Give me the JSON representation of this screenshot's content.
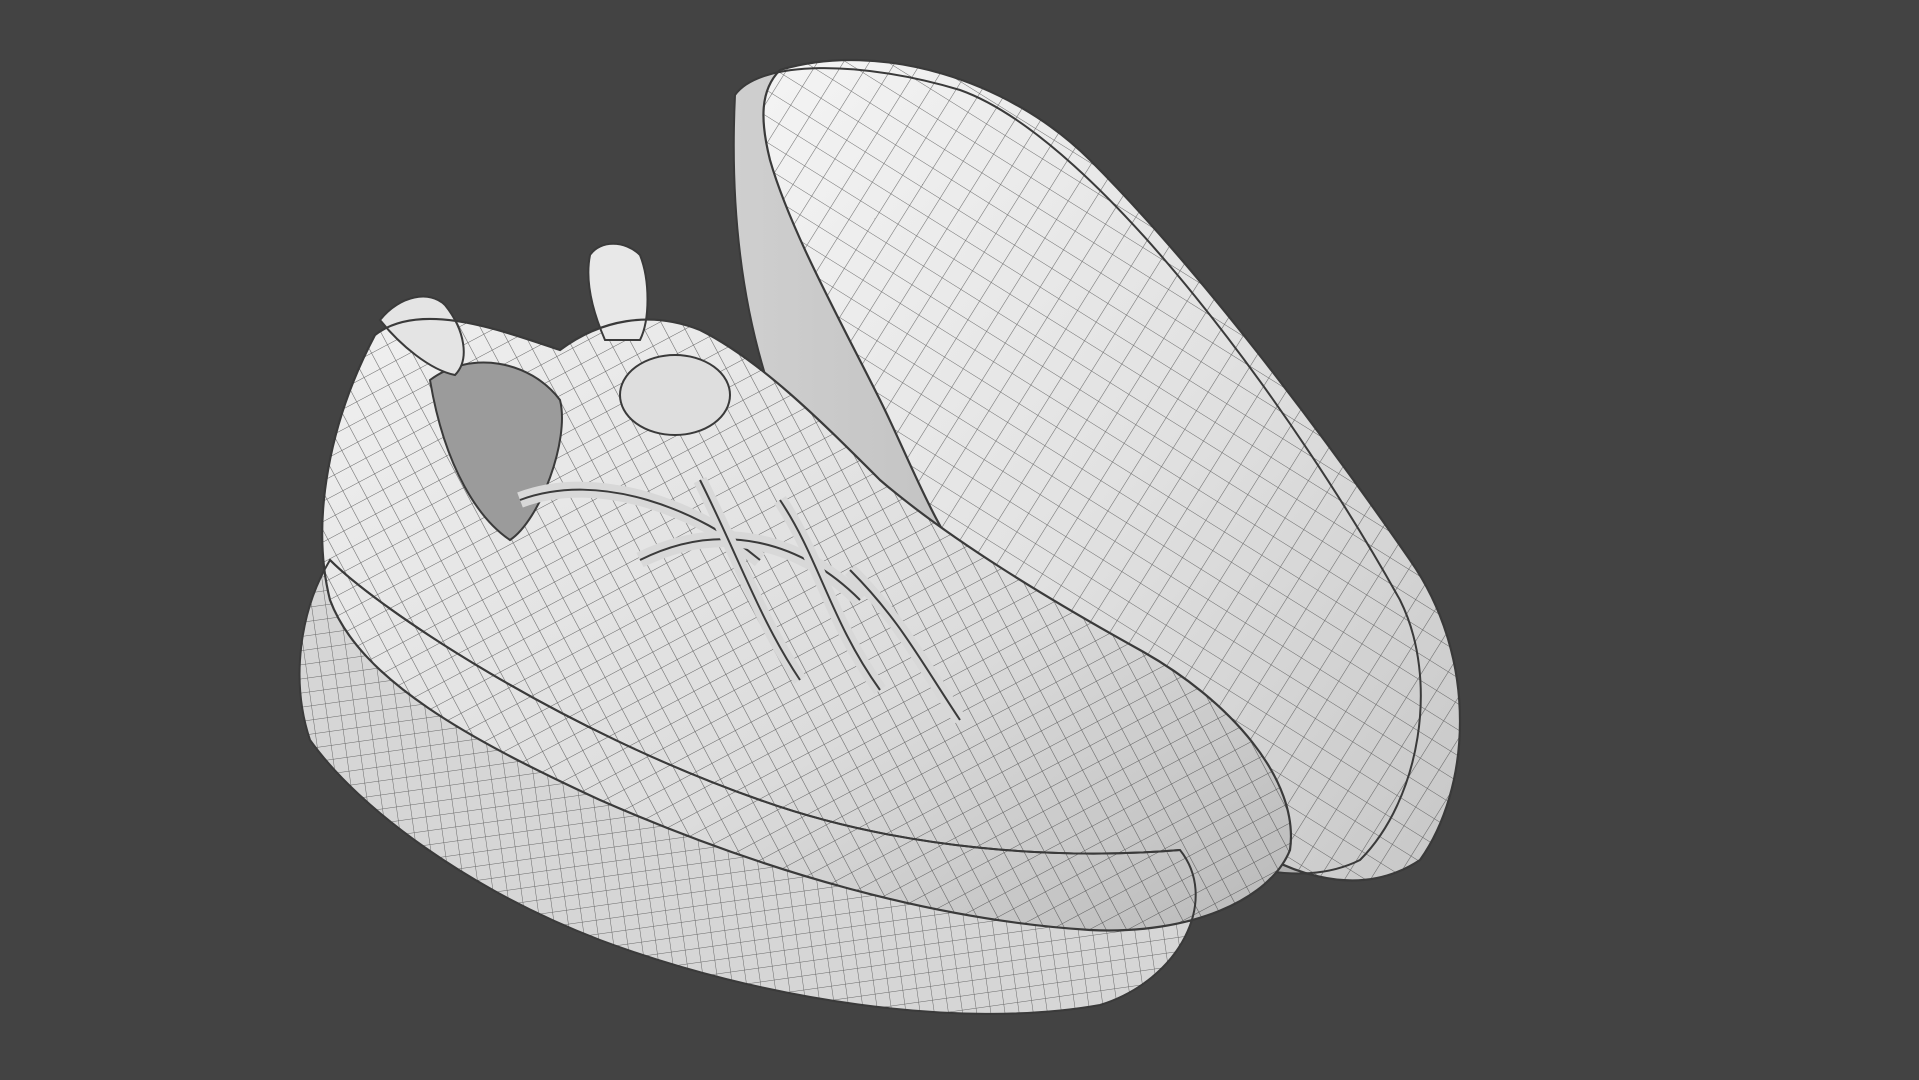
{
  "viewport": {
    "background_color": "#434343",
    "render_mode": "wireframe-on-shaded",
    "objects": [
      {
        "name": "left-shoe",
        "view": "side-top",
        "color": "#e6e6e6",
        "wire_color": "#3a3a3a"
      },
      {
        "name": "right-shoe",
        "view": "sole-up",
        "color": "#e9e9e9",
        "wire_color": "#3a3a3a"
      }
    ]
  }
}
